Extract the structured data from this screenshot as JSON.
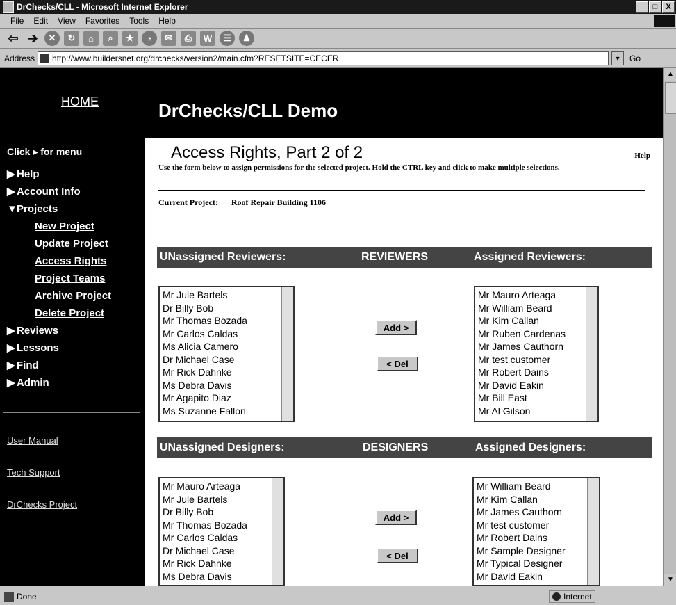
{
  "window": {
    "title": "DrChecks/CLL - Microsoft Internet Explorer",
    "buttons": [
      "_",
      "□",
      "X"
    ]
  },
  "menubar": [
    "File",
    "Edit",
    "View",
    "Favorites",
    "Tools",
    "Help"
  ],
  "toolbar": {
    "icons": [
      "back-icon",
      "forward-icon",
      "stop-icon",
      "refresh-icon",
      "home-icon",
      "search-icon",
      "favorites-icon",
      "history-icon",
      "mail-icon",
      "print-icon",
      "edit-icon",
      "discuss-icon",
      "messenger-icon"
    ]
  },
  "address": {
    "label": "Address",
    "url": "http://www.buildersnet.org/drchecks/version2/main.cfm?RESETSITE=CECER",
    "go": "Go"
  },
  "sidebar": {
    "home": "HOME",
    "click_for_menu": "Click ▸ for menu",
    "items": [
      {
        "label": "Help",
        "marker": "▶"
      },
      {
        "label": "Account Info",
        "marker": "▶"
      },
      {
        "label": "Projects",
        "marker": "▼"
      }
    ],
    "subitems": [
      "New Project",
      "Update Project",
      "Access Rights",
      "Project Teams",
      "Archive Project",
      "Delete Project"
    ],
    "items2": [
      {
        "label": "Reviews",
        "marker": "▶"
      },
      {
        "label": "Lessons",
        "marker": "▶"
      },
      {
        "label": "Find",
        "marker": "▶"
      },
      {
        "label": "Admin",
        "marker": "▶"
      }
    ],
    "links": [
      "User Manual",
      "Tech Support",
      "DrChecks Project"
    ]
  },
  "header": {
    "title": "DrChecks/CLL Demo"
  },
  "main": {
    "heading": "Access Rights, Part 2 of 2",
    "help": "Help",
    "description": "Use the form below to assign permissions for the selected project. Hold the CTRL key and click to make multiple selections.",
    "current_project_label": "Current Project:",
    "current_project": "Roof Repair Building 1106"
  },
  "reviewers": {
    "band_left": "UNassigned Reviewers:",
    "band_mid": "REVIEWERS",
    "band_right": "Assigned Reviewers:",
    "unassigned": [
      "Mr Jule Bartels",
      "Dr Billy Bob",
      "Mr Thomas Bozada",
      "Mr Carlos Caldas",
      "Ms Alicia Camero",
      "Dr Michael Case",
      "Mr Rick Dahnke",
      "Ms Debra Davis",
      "Mr Agapito Diaz",
      "Ms Suzanne Fallon"
    ],
    "assigned": [
      "Mr Mauro Arteaga",
      "Mr William Beard",
      "Mr Kim Callan",
      "Mr Ruben Cardenas",
      "Mr James Cauthorn",
      "Mr test customer",
      "Mr Robert Dains",
      "Mr David Eakin",
      "Mr Bill East",
      "Mr Al Gilson"
    ],
    "add": "Add >",
    "del": "< Del"
  },
  "designers": {
    "band_left": "UNassigned Designers:",
    "band_mid": "DESIGNERS",
    "band_right": "Assigned Designers:",
    "unassigned": [
      "Mr Mauro Arteaga",
      "Mr Jule Bartels",
      "Dr Billy Bob",
      "Mr Thomas Bozada",
      "Mr Carlos Caldas",
      "Dr Michael Case",
      "Mr Rick Dahnke",
      "Ms Debra Davis"
    ],
    "assigned": [
      "Mr William Beard",
      "Mr Kim Callan",
      "Mr James Cauthorn",
      "Mr test customer",
      "Mr Robert Dains",
      "Mr Sample Designer",
      "Mr Typical Designer",
      "Mr David Eakin"
    ],
    "add": "Add >",
    "del": "< Del"
  },
  "status": {
    "text": "Done",
    "zone": "Internet"
  }
}
